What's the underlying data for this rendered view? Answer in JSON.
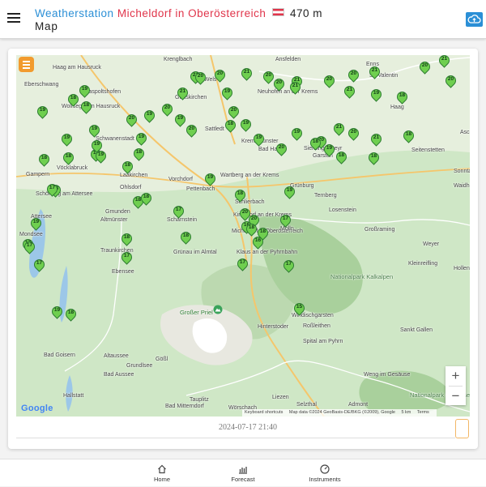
{
  "header": {
    "title_part1": "Weatherstation",
    "title_part2": "Micheldorf in Oberösterreich",
    "title_part3": "470 m",
    "subtitle": "Map",
    "menu_icon": "hamburger-menu-icon",
    "cloud_icon": "cloud-upload-icon",
    "flag": "austria-flag"
  },
  "map": {
    "layer_button_icon": "layers-icon",
    "places": [
      {
        "name": "Krenglbach"
      },
      {
        "name": "Wels"
      },
      {
        "name": "Ansfelden"
      },
      {
        "name": "Enns"
      },
      {
        "name": "St. Valentin"
      },
      {
        "name": "Haag am Hausruck"
      },
      {
        "name": "Eberschwang"
      },
      {
        "name": "Gaspoltshofen"
      },
      {
        "name": "Wolfsegg am Hausruck"
      },
      {
        "name": "Gunskirchen"
      },
      {
        "name": "Neuhofen an der Krems"
      },
      {
        "name": "Haag"
      },
      {
        "name": "Schwanenstadt"
      },
      {
        "name": "Sattledt"
      },
      {
        "name": "Kremsmünster"
      },
      {
        "name": "Bad Hall"
      },
      {
        "name": "Sierning"
      },
      {
        "name": "Garsten"
      },
      {
        "name": "Steyr"
      },
      {
        "name": "Seitenstetten"
      },
      {
        "name": "Aschbach-Markt"
      },
      {
        "name": "Vöcklabruck"
      },
      {
        "name": "Gampern"
      },
      {
        "name": "Laakirchen"
      },
      {
        "name": "Ohlsdorf"
      },
      {
        "name": "Vorchdorf"
      },
      {
        "name": "Wartberg an der Krems"
      },
      {
        "name": "Sonntagberg"
      },
      {
        "name": "Schörfling am Attersee"
      },
      {
        "name": "Pettenbach"
      },
      {
        "name": "Grünburg"
      },
      {
        "name": "Ternberg"
      },
      {
        "name": "Waidhofen an der Ybbs"
      },
      {
        "name": "Gmunden"
      },
      {
        "name": "Altmünster"
      },
      {
        "name": "Scharnstein"
      },
      {
        "name": "Schlierbach"
      },
      {
        "name": "Kirchdorf an der Krems"
      },
      {
        "name": "Micheldorf in Oberösterreich"
      },
      {
        "name": "Molln"
      },
      {
        "name": "Losenstein"
      },
      {
        "name": "Großraming"
      },
      {
        "name": "Weyer"
      },
      {
        "name": "Traunkirchen"
      },
      {
        "name": "Grünau im Almtal"
      },
      {
        "name": "Klaus an der Pyhrnbahn"
      },
      {
        "name": "Kleinreifling"
      },
      {
        "name": "Hollenstein an der Ybbs"
      },
      {
        "name": "Ebensee"
      },
      {
        "name": "Nationalpark Kalkalpen"
      },
      {
        "name": "Großer Priel"
      },
      {
        "name": "Windischgarsten"
      },
      {
        "name": "Hinterstoder"
      },
      {
        "name": "Roßleithen"
      },
      {
        "name": "Sankt Gallen"
      },
      {
        "name": "Spital am Pyhrn"
      },
      {
        "name": "Bad Goisern"
      },
      {
        "name": "Altaussee"
      },
      {
        "name": "Grundlsee"
      },
      {
        "name": "Gößl"
      },
      {
        "name": "Bad Aussee"
      },
      {
        "name": "Weng im Gesäuse"
      },
      {
        "name": "Nationalpark Gesäuse"
      },
      {
        "name": "Hallstatt"
      },
      {
        "name": "Tauplitz"
      },
      {
        "name": "Bad Mitterndorf"
      },
      {
        "name": "Liezen"
      },
      {
        "name": "Selzthal"
      },
      {
        "name": "Wörschach"
      },
      {
        "name": "Admont"
      },
      {
        "name": "Attersee"
      },
      {
        "name": "Mondsee"
      }
    ],
    "markers": [
      {
        "value": "21"
      },
      {
        "value": "20"
      },
      {
        "value": "21"
      },
      {
        "value": "20"
      },
      {
        "value": "21"
      },
      {
        "value": "20"
      },
      {
        "value": "21"
      },
      {
        "value": "20"
      },
      {
        "value": "21"
      },
      {
        "value": "20"
      },
      {
        "value": "19"
      },
      {
        "value": "18"
      },
      {
        "value": "19"
      },
      {
        "value": "18"
      },
      {
        "value": "19"
      },
      {
        "value": "20"
      },
      {
        "value": "19"
      },
      {
        "value": "20"
      },
      {
        "value": "21"
      },
      {
        "value": "20"
      },
      {
        "value": "19"
      },
      {
        "value": "20"
      },
      {
        "value": "19"
      },
      {
        "value": "20"
      },
      {
        "value": "20"
      },
      {
        "value": "21"
      },
      {
        "value": "20"
      },
      {
        "value": "21"
      },
      {
        "value": "19"
      },
      {
        "value": "18"
      },
      {
        "value": "19"
      },
      {
        "value": "18"
      },
      {
        "value": "19"
      },
      {
        "value": "20"
      },
      {
        "value": "19"
      },
      {
        "value": "20"
      },
      {
        "value": "21"
      },
      {
        "value": "20"
      },
      {
        "value": "21"
      },
      {
        "value": "18"
      },
      {
        "value": "19"
      },
      {
        "value": "18"
      },
      {
        "value": "19"
      },
      {
        "value": "19"
      },
      {
        "value": "19"
      },
      {
        "value": "18"
      },
      {
        "value": "18"
      },
      {
        "value": "19"
      },
      {
        "value": "18"
      },
      {
        "value": "18"
      },
      {
        "value": "19"
      },
      {
        "value": "18"
      },
      {
        "value": "20"
      },
      {
        "value": "20"
      },
      {
        "value": "18"
      },
      {
        "value": "19"
      },
      {
        "value": "18"
      },
      {
        "value": "19"
      },
      {
        "value": "18"
      },
      {
        "value": "18"
      },
      {
        "value": "19"
      },
      {
        "value": "17"
      },
      {
        "value": "17"
      },
      {
        "value": "18"
      },
      {
        "value": "18"
      },
      {
        "value": "17"
      },
      {
        "value": "18"
      },
      {
        "value": "17"
      },
      {
        "value": "18"
      },
      {
        "value": "17"
      },
      {
        "value": "16"
      },
      {
        "value": "18"
      },
      {
        "value": "16"
      },
      {
        "value": "17"
      },
      {
        "value": "17"
      },
      {
        "value": "15"
      },
      {
        "value": "17"
      },
      {
        "value": "17"
      },
      {
        "value": "18"
      },
      {
        "value": "19"
      }
    ],
    "zoom_in_label": "+",
    "zoom_out_label": "−",
    "google_logo": "Google",
    "attribution": {
      "shortcuts": "Keyboard shortcuts",
      "data": "Map data ©2024 GeoBasis-DE/BKG (©2009), Google",
      "scale": "5 km",
      "terms": "Terms"
    }
  },
  "timeline": {
    "label": "2024-07-17 21:40"
  },
  "nav": {
    "items": [
      {
        "label": "Home",
        "icon": "home-icon"
      },
      {
        "label": "Forecast",
        "icon": "forecast-chart-icon"
      },
      {
        "label": "Instruments",
        "icon": "gauge-icon"
      }
    ]
  },
  "colors": {
    "accent_blue": "#2b8fd6",
    "accent_red": "#e0344a",
    "marker_green": "#6fcf4f",
    "layer_orange": "#f29b2e"
  }
}
